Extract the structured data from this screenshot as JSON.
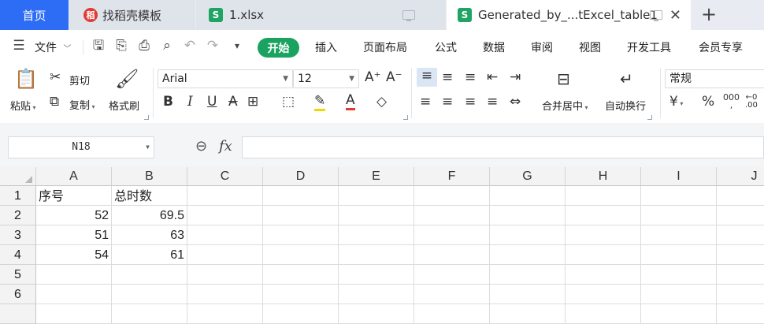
{
  "tabs": {
    "home": "首页",
    "template": "找稻壳模板",
    "file1": "1.xlsx",
    "active": "Generated_by_...tExcel_table1"
  },
  "menu": {
    "file": "文件",
    "items": [
      "开始",
      "插入",
      "页面布局",
      "公式",
      "数据",
      "审阅",
      "视图",
      "开发工具",
      "会员专享"
    ]
  },
  "ribbon": {
    "paste": "粘贴",
    "cut": "剪切",
    "copy": "复制",
    "format_painter": "格式刷",
    "font_name": "Arial",
    "font_size": "12",
    "merge_center": "合并居中",
    "wrap_text": "自动换行",
    "number_format": "常规",
    "currency_symbol": "¥",
    "percent_symbol": "%"
  },
  "formula_bar": {
    "name_box": "N18",
    "fx": "fx",
    "formula": ""
  },
  "sheet": {
    "columns": [
      "A",
      "B",
      "C",
      "D",
      "E",
      "F",
      "G",
      "H",
      "I",
      "J"
    ],
    "rows": [
      "1",
      "2",
      "3",
      "4",
      "5",
      "6"
    ],
    "cells": [
      [
        "序号",
        "总时数"
      ],
      [
        "52",
        "69.5"
      ],
      [
        "51",
        "63"
      ],
      [
        "54",
        "61"
      ]
    ]
  },
  "colors": {
    "home_tab": "#2d6df6",
    "start_button": "#1aa261",
    "sheet_icon": "#1fa463",
    "docer_icon": "#e23a35"
  }
}
